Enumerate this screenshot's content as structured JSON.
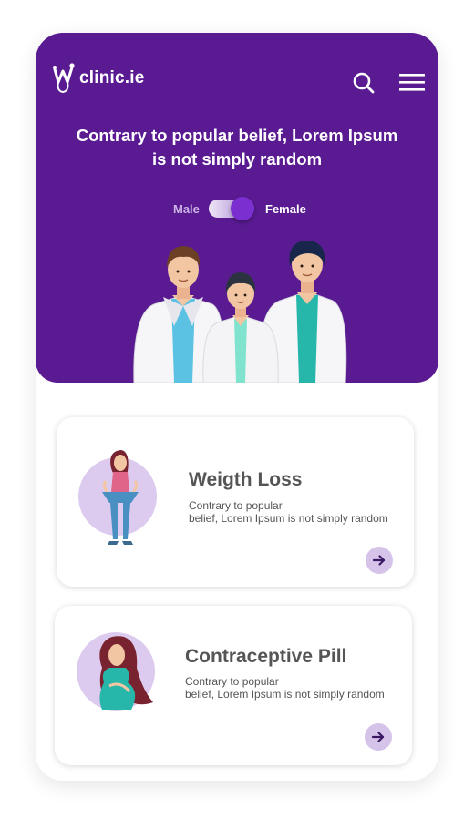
{
  "header": {
    "logo_text": "clinic.ie",
    "logo_icon": "stethoscope-w-icon",
    "search_icon": "search-icon",
    "menu_icon": "hamburger-menu-icon"
  },
  "hero": {
    "headline_line1": "Contrary to popular belief, Lorem Ipsum",
    "headline_line2": "is not simply random",
    "toggle": {
      "left_label": "Male",
      "right_label": "Female",
      "selected": "Female"
    },
    "illustration": "three-doctors-illustration"
  },
  "cards": [
    {
      "title": "Weigth Loss",
      "desc_line1": "Contrary to popular",
      "desc_line2": "belief, Lorem Ipsum is not simply random",
      "image": "weight-loss-woman-illustration",
      "action_icon": "arrow-right-icon"
    },
    {
      "title": "Contraceptive Pill",
      "desc_line1": "Contrary to popular",
      "desc_line2": "belief, Lorem Ipsum is not simply random",
      "image": "pregnant-woman-illustration",
      "action_icon": "arrow-right-icon"
    }
  ],
  "colors": {
    "brand_purple": "#5a1b92",
    "toggle_knob": "#7b2fd0",
    "avatar_bg": "#dccbee",
    "text_gray": "#555555"
  }
}
